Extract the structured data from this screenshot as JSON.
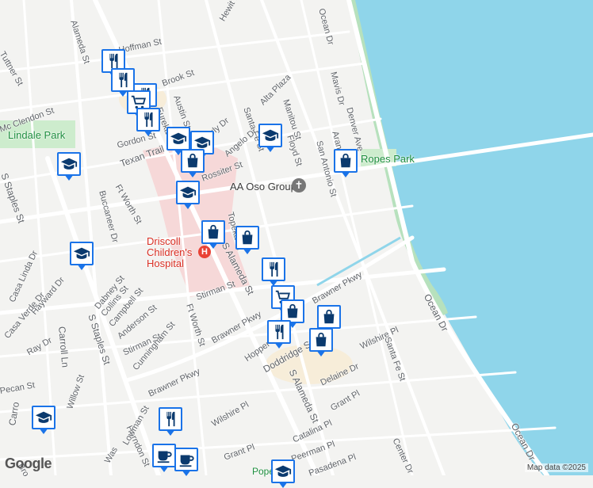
{
  "colors": {
    "water": "#8fd5ea",
    "park": "#c9ebc9",
    "hospital": "#f6d6d6",
    "road": "#ffffff",
    "land": "#f3f3f1",
    "pin": "#1a73e8",
    "shore": "#a8dcb0"
  },
  "labels": {
    "park_lindale": "Lindale Park",
    "park_ropes": "Ropes Park",
    "poi_aa": "AA Oso Group",
    "hospital": "Driscoll Children's Hospital",
    "map_data": "Map data ©2025",
    "logo": "Google"
  },
  "streets": {
    "alameda_top": "Alameda St",
    "hoffman": "Hoffman St",
    "hewit": "Hewit Dr",
    "ocean_top": "Ocean Dr",
    "mavis": "Mavis Dr",
    "denver": "Denver Ave",
    "aransas": "Aransas St",
    "brook": "Brook St",
    "austin": "Austin St",
    "eureka": "Eureka St",
    "alta": "Alta Plaza",
    "manitou": "Manitou St",
    "floyd": "Floyd St",
    "santafe_top": "Santa Fe St",
    "beverly": "Beverly Dr",
    "angelo": "Angelo Dr",
    "sanantonio": "San Antonio St",
    "gordon": "Gordon St",
    "texan": "Texan Trail",
    "rossiter": "Rossiter St",
    "mcclendon": "Mc Clendon St",
    "tuttner": "Tuttner St",
    "staples_nw": "S Staples St",
    "buccaneer": "Buccaneer Dr",
    "ftworth_n": "Ft Worth St",
    "topeka": "Topeka St",
    "salameda_mid": "S Alameda St",
    "casalinda": "Casa Linda Dr",
    "dabney": "Dabney St",
    "collins": "Collins St",
    "campbell": "Campbell St",
    "hayward": "Hayward Dr",
    "casaverde": "Casa Verde Dr",
    "anderson": "Anderson St",
    "stirman_w": "Stirman St",
    "stirman_e": "Stirman St",
    "ftworth_s": "Ft Worth St",
    "brawner_ne": "Brawner Pkwy",
    "brawner_mid": "Brawner Pkwy",
    "brawner_sw": "Brawner Pkwy",
    "raydr": "Ray Dr",
    "carroll": "Carroll Ln",
    "sstaples_s": "S Staples St",
    "cunningham": "Cunningham St",
    "hopper": "Hopper Dr",
    "doddridge": "Doddridge St",
    "salameda_s": "S Alameda St",
    "delaine": "Delaine Dr",
    "wilshire_e": "Wilshire Pl",
    "santafe_s": "Santa Fe St",
    "ocean_mid": "Ocean Dr",
    "ocean_s": "Ocean Dr",
    "grant_e": "Grant Pl",
    "catalina": "Catalina Pl",
    "peerman": "Peerman Pl",
    "pasadena": "Pasadena Pl",
    "center": "Center Dr",
    "wilshire_w": "Wilshire Pl",
    "grant_w": "Grant Pl",
    "willow": "Willow St",
    "pecan": "Pecan St",
    "herndon": "Herndon St",
    "lowman": "Lowman St",
    "carroll_s": "Carro",
    "wa": "Was",
    "pope": "Pope",
    "br_s": "Bro"
  },
  "pins": [
    {
      "icon": "restaurant"
    },
    {
      "icon": "restaurant"
    },
    {
      "icon": "restaurant"
    },
    {
      "icon": "shopping-cart"
    },
    {
      "icon": "restaurant"
    },
    {
      "icon": "education"
    },
    {
      "icon": "education"
    },
    {
      "icon": "education"
    },
    {
      "icon": "shopping-bag"
    },
    {
      "icon": "shopping-bag"
    },
    {
      "icon": "education"
    },
    {
      "icon": "shopping-bag"
    },
    {
      "icon": "shopping-bag"
    },
    {
      "icon": "education"
    },
    {
      "icon": "restaurant"
    },
    {
      "icon": "shopping-cart"
    },
    {
      "icon": "shopping-bag"
    },
    {
      "icon": "restaurant"
    },
    {
      "icon": "shopping-bag"
    },
    {
      "icon": "shopping-bag"
    },
    {
      "icon": "education"
    },
    {
      "icon": "restaurant"
    },
    {
      "icon": "coffee"
    },
    {
      "icon": "coffee"
    },
    {
      "icon": "education"
    }
  ]
}
